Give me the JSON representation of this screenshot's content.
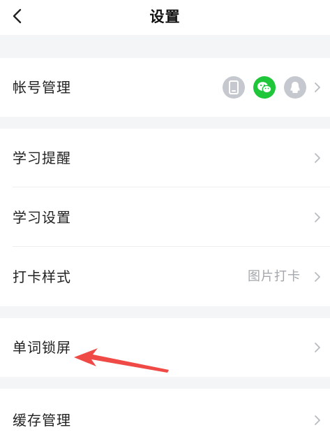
{
  "header": {
    "title": "设置"
  },
  "rows": {
    "account": {
      "label": "帐号管理"
    },
    "reminder": {
      "label": "学习提醒"
    },
    "study_settings": {
      "label": "学习设置"
    },
    "checkin_style": {
      "label": "打卡样式",
      "value": "图片打卡"
    },
    "word_lockscreen": {
      "label": "单词锁屏"
    },
    "cache": {
      "label": "缓存管理"
    }
  },
  "login_methods": [
    {
      "icon": "phone-icon",
      "color": "#c5c9cf"
    },
    {
      "icon": "wechat-icon",
      "color": "#1fc63a"
    },
    {
      "icon": "qq-icon",
      "color": "#c5c9cf"
    }
  ],
  "colors": {
    "section_gap": "#f4f5f6",
    "annotation_arrow": "#f04a46"
  }
}
